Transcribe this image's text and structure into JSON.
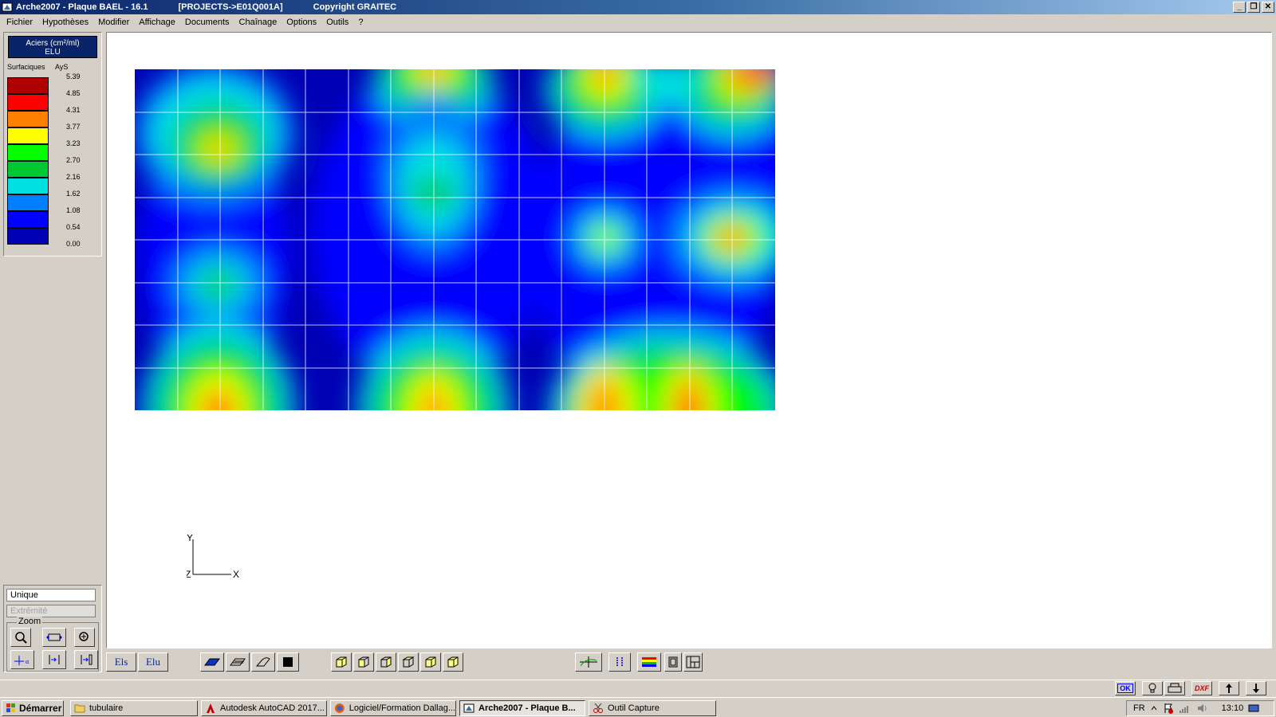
{
  "window": {
    "title": "Arche2007 - Plaque BAEL - 16.1",
    "project": "[PROJECTS->E01Q001A]",
    "copyright": "Copyright GRAITEC",
    "minimize": "_",
    "restore": "❐",
    "close": "✕"
  },
  "menu": [
    "Fichier",
    "Hypothèses",
    "Modifier",
    "Affichage",
    "Documents",
    "Chaînage",
    "Options",
    "Outils",
    "?"
  ],
  "legend": {
    "title_line1": "Aciers (cm²/ml)",
    "title_line2": "ELU",
    "col1": "Surfaciques",
    "col2": "AyS",
    "values": [
      "5.39",
      "4.85",
      "4.31",
      "3.77",
      "3.23",
      "2.70",
      "2.16",
      "1.62",
      "1.08",
      "0.54",
      "0.00"
    ],
    "colors": [
      "#b00000",
      "#ff0000",
      "#ff8000",
      "#ffff00",
      "#00ff00",
      "#00c832",
      "#00e0e0",
      "#0080ff",
      "#0000ff",
      "#0000b4"
    ]
  },
  "options": {
    "unique": "Unique",
    "extremite": "Extrémité",
    "zoom_label": "Zoom"
  },
  "axes": {
    "y": "Y",
    "x": "X",
    "z": "Z"
  },
  "toolbar": {
    "els": "Els",
    "elu": "Elu"
  },
  "statusbar": {
    "ok": "OK",
    "dxf": "DXF"
  },
  "taskbar": {
    "start": "Démarrer",
    "items": [
      {
        "label": "tubulaire"
      },
      {
        "label": "Autodesk AutoCAD 2017..."
      },
      {
        "label": "Logiciel/Formation Dallag..."
      },
      {
        "label": "Arche2007 - Plaque B..."
      },
      {
        "label": "Outil Capture"
      }
    ],
    "lang": "FR",
    "time": "13:10"
  }
}
